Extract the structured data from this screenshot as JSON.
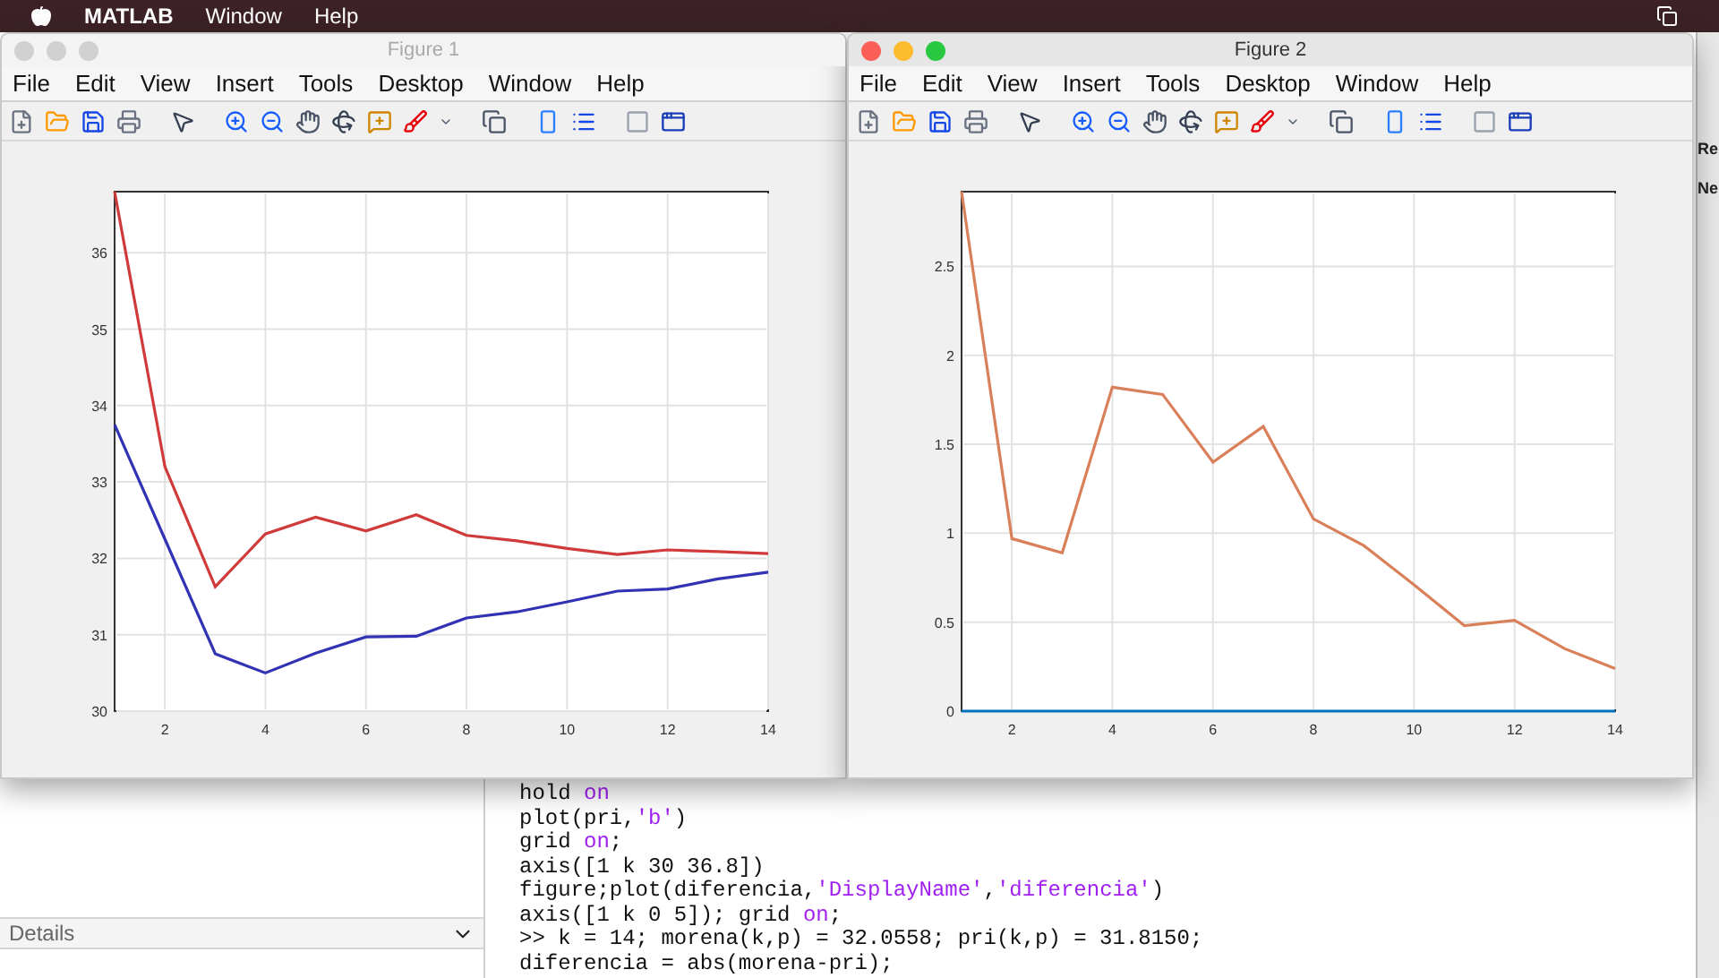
{
  "menu_bar": {
    "app_name": "MATLAB",
    "items": [
      "Window",
      "Help"
    ]
  },
  "right_strip": {
    "labels": [
      "Re",
      "Ne"
    ]
  },
  "figures": [
    {
      "title": "Figure 1",
      "active": false,
      "menu": [
        "File",
        "Edit",
        "View",
        "Insert",
        "Tools",
        "Desktop",
        "Window",
        "Help"
      ],
      "chart_data": {
        "type": "line",
        "grid": true,
        "x": [
          1,
          2,
          3,
          4,
          5,
          6,
          7,
          8,
          9,
          10,
          11,
          12,
          13,
          14
        ],
        "xlim": [
          1,
          14
        ],
        "ylim": [
          30,
          36.8
        ],
        "xticks": [
          2,
          4,
          6,
          8,
          10,
          12,
          14
        ],
        "yticks": [
          30,
          31,
          32,
          33,
          34,
          35,
          36
        ],
        "series": [
          {
            "color": "#d03a3a",
            "values": [
              36.8,
              33.2,
              31.63,
              32.32,
              32.54,
              32.36,
              32.57,
              32.3,
              32.23,
              32.13,
              32.05,
              32.11,
              32.09,
              32.06
            ]
          },
          {
            "color": "#3232b4",
            "values": [
              33.75,
              32.25,
              30.75,
              30.5,
              30.76,
              30.97,
              30.98,
              31.22,
              31.3,
              31.43,
              31.57,
              31.6,
              31.73,
              31.82
            ]
          }
        ]
      }
    },
    {
      "title": "Figure 2",
      "active": true,
      "menu": [
        "File",
        "Edit",
        "View",
        "Insert",
        "Tools",
        "Desktop",
        "Window",
        "Help"
      ],
      "chart_data": {
        "type": "line",
        "grid": true,
        "x": [
          1,
          2,
          3,
          4,
          5,
          6,
          7,
          8,
          9,
          10,
          11,
          12,
          13,
          14
        ],
        "xlim": [
          1,
          14
        ],
        "ylim": [
          0,
          2.92
        ],
        "xticks": [
          2,
          4,
          6,
          8,
          10,
          12,
          14
        ],
        "yticks": [
          0,
          0.5,
          1,
          1.5,
          2,
          2.5
        ],
        "series": [
          {
            "color": "#0072bd",
            "values": [
              0,
              0,
              0,
              0,
              0,
              0,
              0,
              0,
              0,
              0,
              0,
              0,
              0,
              0
            ]
          },
          {
            "color": "#d9805a",
            "values": [
              2.92,
              0.97,
              0.89,
              1.82,
              1.78,
              1.4,
              1.6,
              1.08,
              0.93,
              0.71,
              0.48,
              0.51,
              0.35,
              0.24
            ]
          }
        ]
      }
    }
  ],
  "details_panel": {
    "title": "Details",
    "expanded": true
  },
  "command_window": {
    "lines": [
      [
        {
          "text": "hold ",
          "kind": "plain"
        },
        {
          "text": "on",
          "kind": "string"
        }
      ],
      [
        {
          "text": "plot(pri,",
          "kind": "plain"
        },
        {
          "text": "'b'",
          "kind": "string"
        },
        {
          "text": ")",
          "kind": "plain"
        }
      ],
      [
        {
          "text": "grid ",
          "kind": "plain"
        },
        {
          "text": "on",
          "kind": "string"
        },
        {
          "text": ";",
          "kind": "plain"
        }
      ],
      [
        {
          "text": "axis([1 k 30 36.8])",
          "kind": "plain"
        }
      ],
      [
        {
          "text": "figure;plot(diferencia,",
          "kind": "plain"
        },
        {
          "text": "'DisplayName'",
          "kind": "string"
        },
        {
          "text": ",",
          "kind": "plain"
        },
        {
          "text": "'diferencia'",
          "kind": "string"
        },
        {
          "text": ")",
          "kind": "plain"
        }
      ],
      [
        {
          "text": "axis([1 k 0 5]); grid ",
          "kind": "plain"
        },
        {
          "text": "on",
          "kind": "string"
        },
        {
          "text": ";",
          "kind": "plain"
        }
      ],
      [
        {
          "text": ">> k = 14; morena(k,p) = 32.0558; pri(k,p) = 31.8150;",
          "kind": "plain"
        }
      ],
      [
        {
          "text": "diferencia = abs(morena-pri);",
          "kind": "plain"
        }
      ]
    ]
  }
}
